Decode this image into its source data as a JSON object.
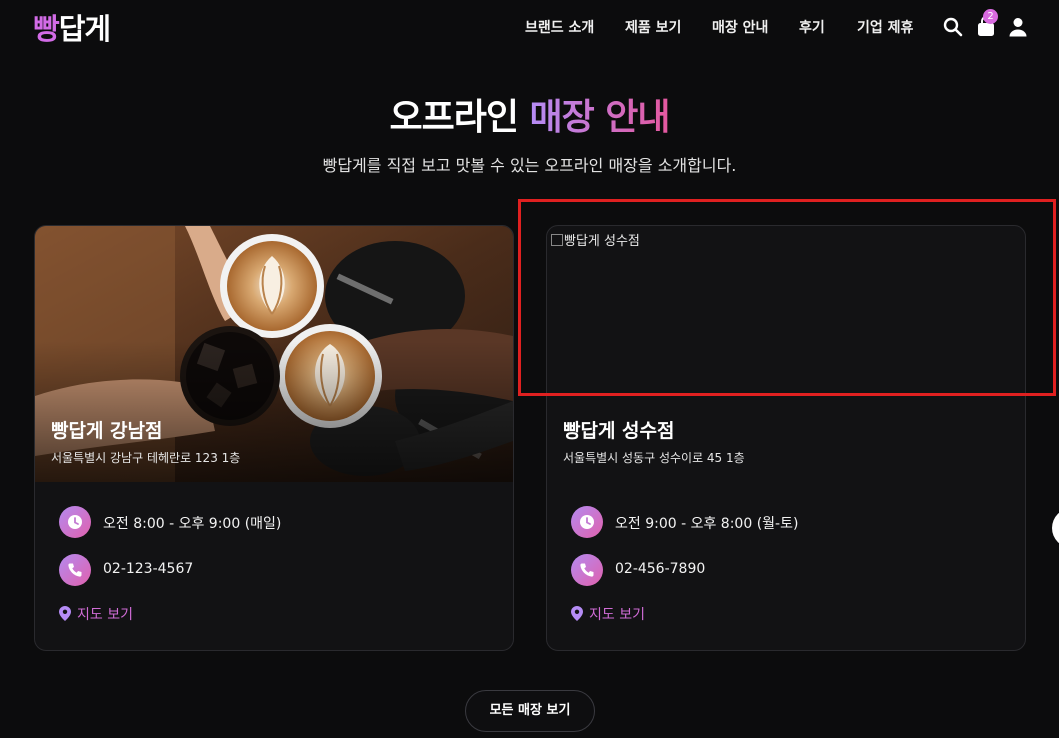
{
  "logo": {
    "accent": "빵",
    "rest": "답게"
  },
  "nav": {
    "items": [
      {
        "label": "브랜드 소개"
      },
      {
        "label": "제품 보기"
      },
      {
        "label": "매장 안내"
      },
      {
        "label": "후기"
      },
      {
        "label": "기업 제휴"
      }
    ],
    "cart_count": "2",
    "icons": [
      "search-icon",
      "cart-icon",
      "user-icon"
    ]
  },
  "hero": {
    "title_plain": "오프라인",
    "title_gradient": "매장 안내",
    "subtitle": "빵답게를 직접 보고 맛볼 수 있는 오프라인 매장을 소개합니다."
  },
  "stores": [
    {
      "name": "빵답게 강남점",
      "address": "서울특별시 강남구 테헤란로 123 1층",
      "hours": "오전 8:00 - 오후 9:00 (매일)",
      "phone": "02-123-4567",
      "map_label": "지도 보기",
      "image": "coffee-cups-photo"
    },
    {
      "name": "빵답게 성수점",
      "address": "서울특별시 성동구 성수이로 45 1층",
      "hours": "오전 9:00 - 오후 8:00 (월-토)",
      "phone": "02-456-7890",
      "map_label": "지도 보기",
      "image_alt": "빵답게 성수점"
    }
  ],
  "all_stores_button": "모든 매장 보기",
  "colors": {
    "background": "#0c0c0d",
    "card": "#121214",
    "accent_purple": "#b48af0",
    "accent_pink": "#e061ad",
    "highlight_red": "#e02020"
  }
}
